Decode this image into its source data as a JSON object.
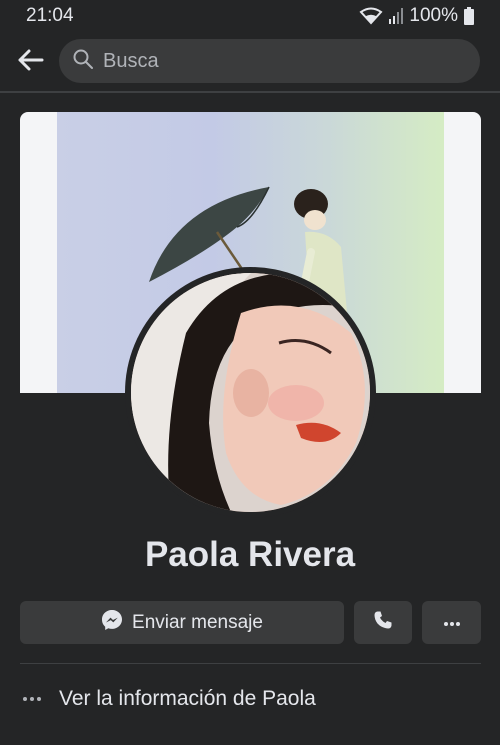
{
  "status_bar": {
    "time": "21:04",
    "battery": "100%"
  },
  "search": {
    "placeholder": "Busca"
  },
  "profile": {
    "name": "Paola Rivera"
  },
  "actions": {
    "message_label": "Enviar mensaje"
  },
  "info_link": {
    "label": "Ver la información de Paola"
  },
  "icons": {
    "back": "arrow-left-icon",
    "search": "search-icon",
    "messenger": "messenger-icon",
    "call": "phone-icon",
    "more": "more-horizontal-icon",
    "wifi": "wifi-icon",
    "signal": "signal-icon",
    "battery": "battery-icon"
  },
  "colors": {
    "background": "#242526",
    "surface": "#3a3b3c",
    "text": "#e4e6eb",
    "muted": "#b0b3b8"
  }
}
